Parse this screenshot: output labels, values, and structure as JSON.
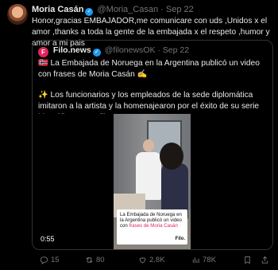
{
  "tweet": {
    "author_name": "Moria Casán",
    "author_handle": "@Moria_Casan",
    "time": "Sep 22",
    "separator": "·",
    "text": "Honor,gracias EMBAJADOR,me comunicare con uds ,Unidos x el amor ,thanks a toda la gente de la embajada x el respeto ,humor y amor a mi pais"
  },
  "quote": {
    "avatar_letter": "F",
    "author_name": "Filo.news",
    "author_handle": "@filonewsOK",
    "time": "Sep 22",
    "separator": "·",
    "paragraph1": "🇳🇴 La Embajada de Noruega en la Argentina publicó un video con frases de Moria Casán ✍️",
    "paragraph2": "✨ Los funcionarios y los empleados de la sede diplomática imitaron a la artista y la homenajearon por el éxito de su serie biográfica en Netflix."
  },
  "video": {
    "caption_main": "La Embajada de Noruega en la Argentina publicó un video con",
    "caption_highlight": "frases de Moria Casán",
    "caption_logo": "Filo.",
    "duration": "0:55"
  },
  "actions": {
    "replies": "15",
    "retweets": "80",
    "likes": "2.8K",
    "views": "78K"
  },
  "colors": {
    "accent": "#1d9bf0",
    "brand": "#e0245e"
  }
}
